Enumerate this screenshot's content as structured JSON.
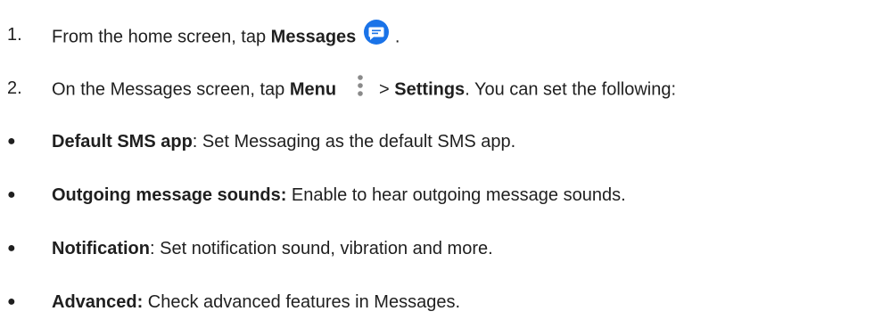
{
  "steps": [
    {
      "number": "1.",
      "prefix": "From the home screen, tap ",
      "bold": "Messages",
      "suffix": " ."
    },
    {
      "number": "2.",
      "prefix": "On the Messages screen, tap ",
      "bold1": "Menu",
      "middle": "> ",
      "bold2": "Settings",
      "suffix": ". You can set the following:"
    }
  ],
  "bullets": [
    {
      "marker": "●",
      "term": "Default SMS app",
      "desc": ": Set Messaging as the default SMS app."
    },
    {
      "marker": "●",
      "term": "Outgoing message sounds:",
      "desc": " Enable to hear outgoing message sounds."
    },
    {
      "marker": "●",
      "term": "Notification",
      "desc": ": Set notification sound, vibration and more."
    },
    {
      "marker": "●",
      "term": "Advanced:",
      "desc": " Check advanced features in Messages."
    }
  ],
  "colors": {
    "messages_icon": "#1a73e8",
    "menu_icon": "#8a8a8a"
  },
  "icons": {
    "messages": "messages-chat-bubble-icon",
    "menu": "more-vertical-dots-icon"
  }
}
